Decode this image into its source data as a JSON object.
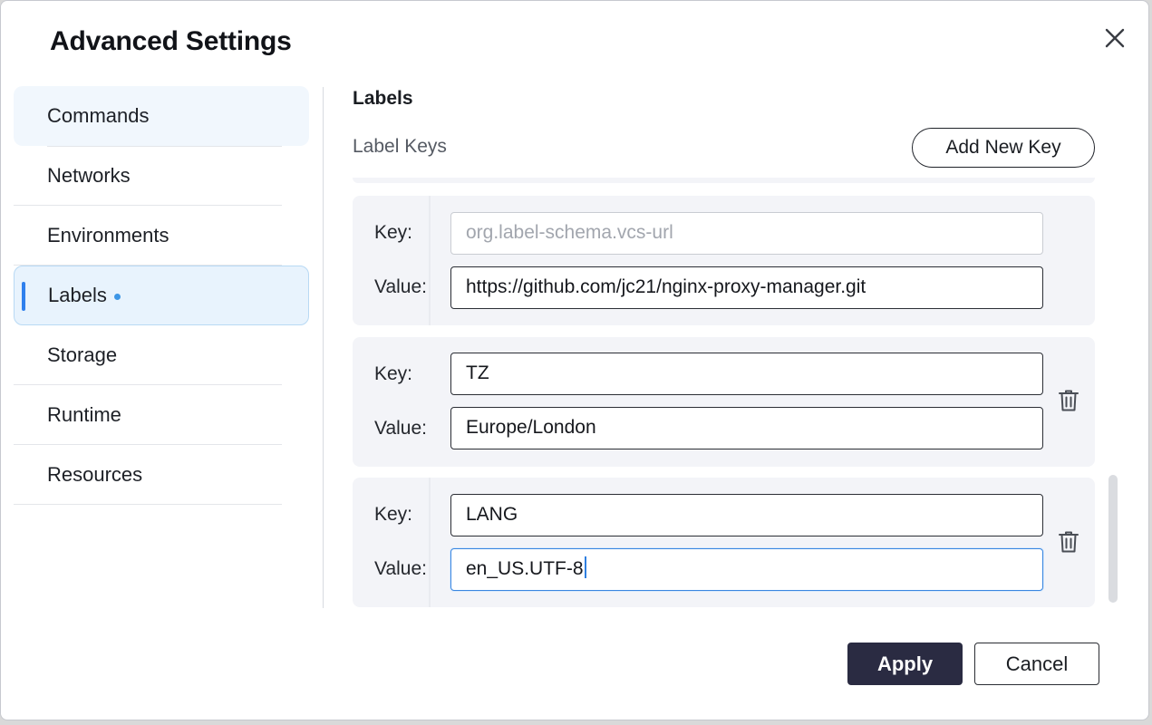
{
  "dialog": {
    "title": "Advanced Settings",
    "close_icon": "close-icon"
  },
  "sidebar": {
    "items": [
      {
        "label": "Commands",
        "state": "hover"
      },
      {
        "label": "Networks"
      },
      {
        "label": "Environments"
      },
      {
        "label": "Labels",
        "state": "active",
        "modified_indicator": true
      },
      {
        "label": "Storage"
      },
      {
        "label": "Runtime"
      },
      {
        "label": "Resources"
      }
    ]
  },
  "labels": {
    "section_title": "Labels",
    "keys_label": "Label Keys",
    "add_button_label": "Add New Key",
    "key_field_label": "Key:",
    "value_field_label": "Value:",
    "delete_icon": "trash-icon",
    "entries": [
      {
        "key": "org.label-schema.vcs-url",
        "value": "https://github.com/jc21/nginx-proxy-manager.git",
        "key_disabled": true,
        "deletable": false
      },
      {
        "key": "TZ",
        "value": "Europe/London",
        "deletable": true
      },
      {
        "key": "LANG",
        "value": "en_US.UTF-8",
        "deletable": true,
        "focused": "value"
      }
    ]
  },
  "footer": {
    "apply_label": "Apply",
    "cancel_label": "Cancel"
  },
  "colors": {
    "accent": "#2f80ed",
    "primary_button": "#2a2b42",
    "active_nav_bg": "#e8f3fd",
    "card_bg": "#f3f4f8"
  }
}
